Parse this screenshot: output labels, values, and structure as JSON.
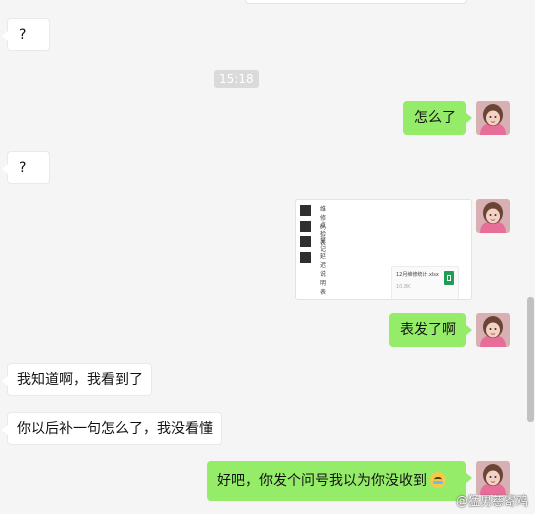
{
  "colors": {
    "background": "#f5f5f5",
    "incoming_bubble": "#ffffff",
    "outgoing_bubble": "#95ec69",
    "timestamp_bg": "#dadada"
  },
  "messages": {
    "m1": "?",
    "timestamp": "15:18",
    "m2": "怎么了",
    "m3": "?",
    "m4": "表发了啊",
    "m5": "我知道啊，我看到了",
    "m6": "你以后补一句怎么了，我没看懂",
    "m7": "好吧，你发个问号我以为你没收到"
  },
  "shared_card": {
    "rows": [
      "维修码",
      "点检表",
      "登记",
      "延迟说明表"
    ],
    "file_name": "12月维修统计.xlsx",
    "file_size": "10.8K",
    "file_icon": "excel-file-icon"
  },
  "watermark": "@猛男慈寄鸡",
  "avatar_icon": "girl-avatar-icon",
  "emoji_icon": "sweat-smile-emoji"
}
